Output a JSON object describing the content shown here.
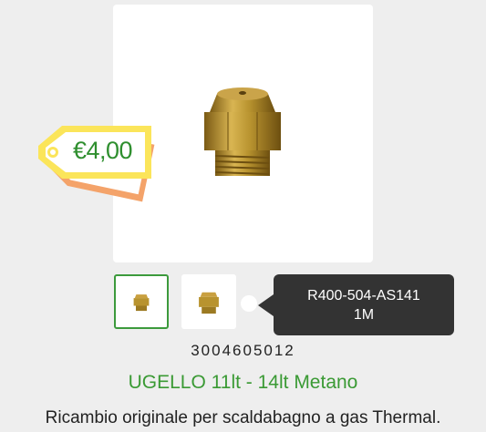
{
  "product": {
    "price": "€4,00",
    "tooltip_line1": "R400-504-AS141",
    "tooltip_line2": "1M",
    "sku": "3004605012",
    "title": "UGELLO 11lt - 14lt Metano",
    "description": "Ricambio originale per scaldabagno a gas Thermal."
  },
  "colors": {
    "accent_green": "#3a9a34",
    "tag_yellow": "#fbe55a",
    "tag_orange": "#f4a36a",
    "tooltip_bg": "#333333",
    "brass": "#b8932f"
  },
  "icons": {
    "price_tag": "price-tag-icon",
    "main_image": "brass-nozzle-image"
  }
}
